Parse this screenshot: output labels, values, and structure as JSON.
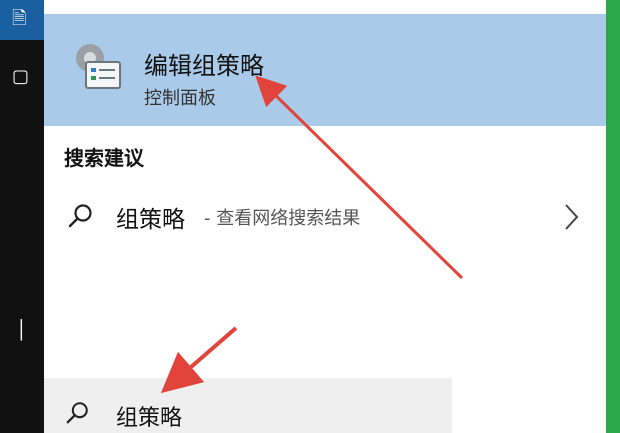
{
  "best_match": {
    "title": "编辑组策略",
    "subtitle": "控制面板",
    "icon": "group-policy-gear-icon"
  },
  "suggestions": {
    "section_title": "搜索建议",
    "items": [
      {
        "term": "组策略",
        "description": "- 查看网络搜索结果"
      }
    ]
  },
  "search": {
    "query": "组策略"
  },
  "colors": {
    "highlight": "#a9cbe9",
    "annotation": "#e0443a",
    "taskbar": "#111111",
    "accent_edge": "#2aa84a"
  }
}
